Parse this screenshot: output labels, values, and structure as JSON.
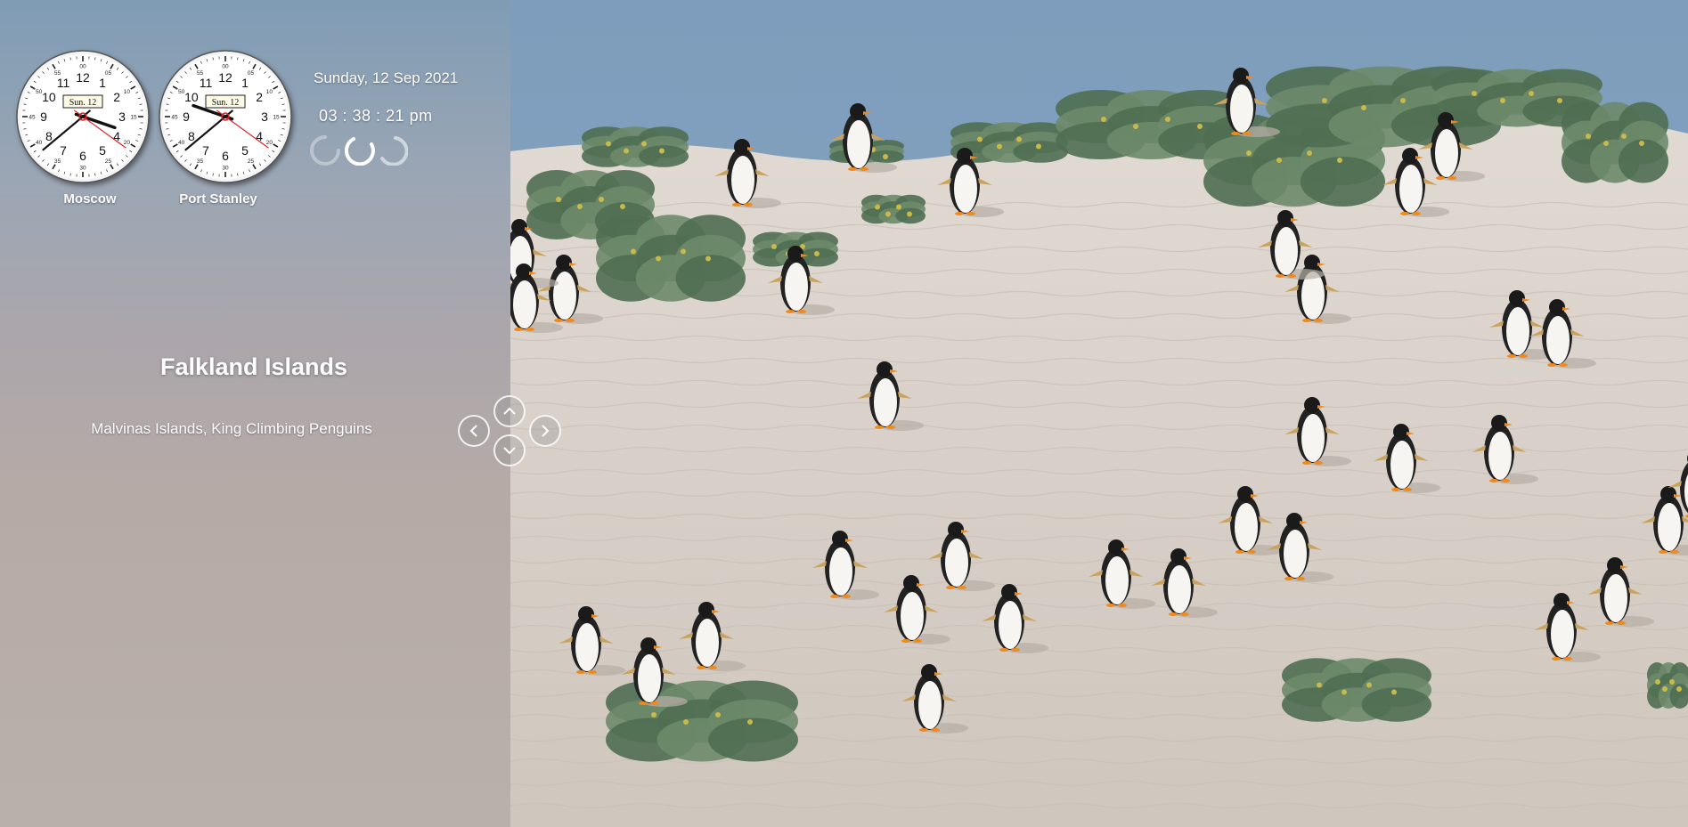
{
  "clocks": [
    {
      "city": "Moscow",
      "date_window": "Sun. 12",
      "hour": 3,
      "minute": 38,
      "second": 21
    },
    {
      "city": "Port Stanley",
      "date_window": "Sun. 12",
      "hour": 9,
      "minute": 38,
      "second": 21
    }
  ],
  "dial_numbers": [
    "12",
    "1",
    "2",
    "3",
    "4",
    "5",
    "6",
    "7",
    "8",
    "9",
    "10",
    "11"
  ],
  "minute_numbers": [
    "00",
    "05",
    "10",
    "15",
    "20",
    "25",
    "30",
    "35",
    "40",
    "45",
    "50",
    "55"
  ],
  "date_line": "Sunday, 12 Sep 2021",
  "time_line": "03 : 38 : 21  pm",
  "location": {
    "title": "Falkland Islands",
    "subtitle": "Malvinas Islands, King Climbing Penguins"
  },
  "nav": {
    "up_icon": "chevron-up-icon",
    "down_icon": "chevron-down-icon",
    "left_icon": "chevron-left-icon",
    "right_icon": "chevron-right-icon"
  },
  "colors": {
    "panel_top": "#7f9cb5",
    "panel_bottom": "#b9b0ab",
    "second_hand": "#e02020",
    "sky": "#7f9fbd",
    "sand": "#d9d2ca",
    "shrub": "#58765a"
  }
}
